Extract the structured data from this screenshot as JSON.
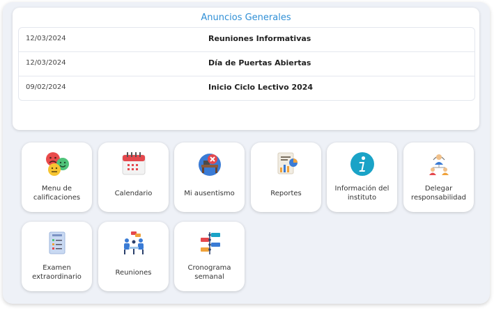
{
  "announcements": {
    "title": "Anuncios Generales",
    "rows": [
      {
        "date": "12/03/2024",
        "subject": "Reuniones Informativas"
      },
      {
        "date": "12/03/2024",
        "subject": "Día de Puertas Abiertas"
      },
      {
        "date": "09/02/2024",
        "subject": "Inicio Ciclo Lectivo 2024"
      }
    ]
  },
  "tiles": [
    {
      "label": "Menu de calificaciones",
      "icon": "smiley-faces-icon"
    },
    {
      "label": "Calendario",
      "icon": "calendar-icon"
    },
    {
      "label": "Mi ausentismo",
      "icon": "absence-icon"
    },
    {
      "label": "Reportes",
      "icon": "report-icon"
    },
    {
      "label": "Información del instituto",
      "icon": "info-icon"
    },
    {
      "label": "Delegar responsabilidad",
      "icon": "delegate-icon"
    },
    {
      "label": "Examen extraordinario",
      "icon": "exam-checklist-icon"
    },
    {
      "label": "Reuniones",
      "icon": "meeting-icon"
    },
    {
      "label": "Cronograma semanal",
      "icon": "timeline-icon"
    }
  ]
}
